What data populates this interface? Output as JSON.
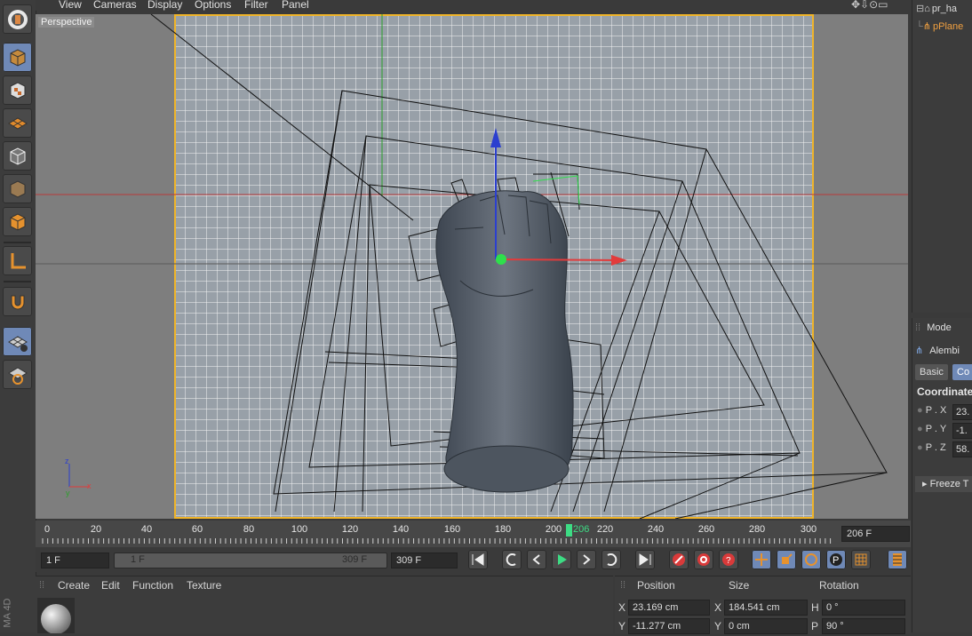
{
  "menubar": {
    "items": [
      "View",
      "Cameras",
      "Display",
      "Options",
      "Filter",
      "Panel"
    ]
  },
  "viewport": {
    "label": "Perspective"
  },
  "left_toolbar": {
    "tools": [
      "cinema4d-logo-icon",
      "model-mode-icon",
      "texture-mode-icon",
      "polygon-mode-icon",
      "edge-mode-icon",
      "point-mode-icon",
      "object-mode-icon",
      "axis-icon",
      "magnet-icon",
      "workplane-icon",
      "snap-icon"
    ]
  },
  "object_manager": {
    "items": [
      "pr_ha",
      "pPlane"
    ]
  },
  "attribute_manager": {
    "mode_label": "Mode",
    "object_name": "Alembi",
    "tabs": [
      "Basic",
      "Co"
    ],
    "section": "Coordinate",
    "rows": [
      {
        "label": "P . X",
        "value": "23."
      },
      {
        "label": "P . Y",
        "value": "-1."
      },
      {
        "label": "P . Z",
        "value": "58."
      }
    ],
    "freeze_label": "Freeze T"
  },
  "timeline": {
    "ticks": [
      "0",
      "20",
      "40",
      "60",
      "80",
      "100",
      "120",
      "140",
      "160",
      "180",
      "200",
      "220",
      "240",
      "260",
      "280",
      "300"
    ],
    "current_frame": "206",
    "end_frame_field": "206 F"
  },
  "transport": {
    "start_field": "1 F",
    "range_start": "1 F",
    "range_end": "309 F",
    "end_field": "309 F"
  },
  "material_manager": {
    "menu": [
      "Create",
      "Edit",
      "Function",
      "Texture"
    ]
  },
  "coordinates": {
    "headers": {
      "position": "Position",
      "size": "Size",
      "rotation": "Rotation"
    },
    "x": {
      "axis": "X",
      "pos": "23.169 cm",
      "size_axis": "X",
      "size": "184.541 cm",
      "rot_axis": "H",
      "rot": "0 °"
    },
    "y": {
      "axis": "Y",
      "pos": "-11.277 cm",
      "size_axis": "Y",
      "size": "0 cm",
      "rot_axis": "P",
      "rot": "90 °"
    }
  },
  "brand": {
    "vertical_text": "MA 4D"
  },
  "colors": {
    "accent": "#6f89b7",
    "viewport_border": "#f0b429",
    "playhead": "#3ddc84"
  }
}
